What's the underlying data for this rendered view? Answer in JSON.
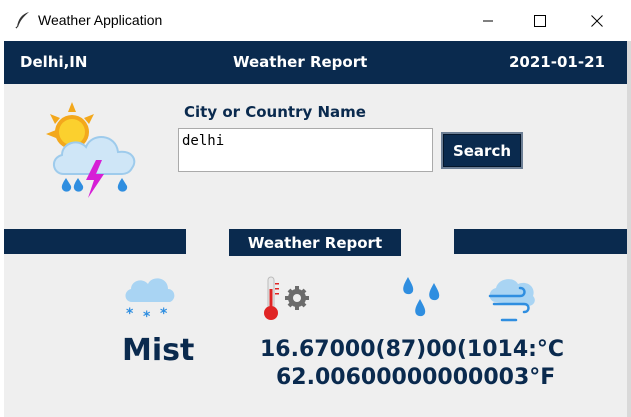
{
  "window": {
    "title": "Weather Application",
    "app_icon": "feather-icon"
  },
  "header": {
    "location": "Delhi,IN",
    "title": "Weather Report",
    "date": "2021-01-21"
  },
  "search": {
    "label": "City or Country Name",
    "value": "delhi",
    "button_label": "Search"
  },
  "section": {
    "title": "Weather Report"
  },
  "report": {
    "condition": "Mist",
    "temperature_c_text": "16.67000(87)00(1014:°C",
    "temperature_f_text": "62.00600000000003°F",
    "icons": [
      "sun-cloud-storm-icon",
      "snow-cloud-icon",
      "thermometer-gear-icon",
      "droplets-icon",
      "wind-icon"
    ]
  },
  "colors": {
    "navy": "#0a2a4e",
    "panel": "#efefef"
  }
}
